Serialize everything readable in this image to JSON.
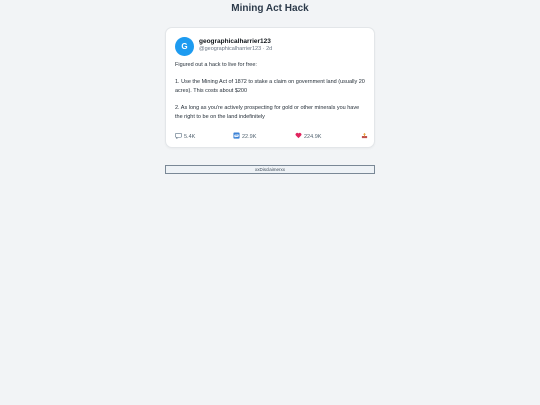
{
  "page": {
    "title": "Mining Act Hack"
  },
  "tweet": {
    "avatar_letter": "G",
    "display_name": "geographicalharrier123",
    "handle": "@geographicalharrier123",
    "separator": "·",
    "time": "2d",
    "body": [
      "Figured out a hack to live for free:",
      "",
      "1. Use the Mining Act of 1872 to stake a claim on government land (usually 20 acres). This costs about $200",
      "",
      "2. As long as you're actively prospecting for gold or other minerals you have the right to be on the land indefinitely"
    ],
    "actions": {
      "replies": "5.4K",
      "retweets": "22.9K",
      "likes": "224.9K",
      "reply_icon": "speech-bubble-icon",
      "retweet_icon": "retweet-icon",
      "like_icon": "heart-icon",
      "share_icon": "share-tray-icon"
    },
    "colors": {
      "avatar": "#1d9bf0",
      "like": "#e0245e",
      "retweet": "#2b7bd6"
    }
  },
  "disclaimer": {
    "label": "xxDisclaimerxx"
  }
}
